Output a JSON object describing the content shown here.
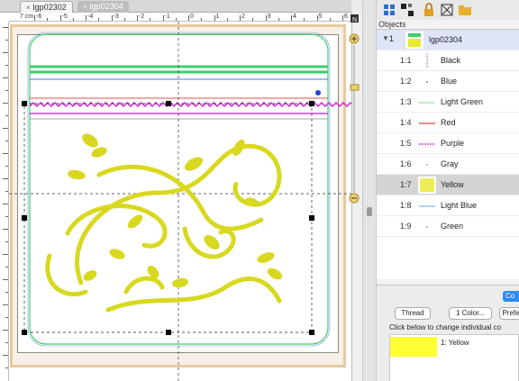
{
  "tabs": [
    {
      "label": "lgp02302",
      "active": true
    },
    {
      "label": "lgp02304",
      "active": false
    }
  ],
  "ruler": {
    "unit": "7 cm",
    "top_labels": [
      "-6",
      "-5",
      "-4",
      "-3",
      "-2",
      "-1",
      "0",
      "1",
      "2",
      "3",
      "4",
      "5",
      "6"
    ]
  },
  "objects": {
    "header": "Objects",
    "parent": {
      "index": "1",
      "name": "lgp02304"
    },
    "items": [
      {
        "index": "1:1",
        "name": "Black",
        "color": "#000000"
      },
      {
        "index": "1:2",
        "name": "Blue",
        "color": "#2046d8"
      },
      {
        "index": "1:3",
        "name": "Light Green",
        "color": "#3ccf6a"
      },
      {
        "index": "1:4",
        "name": "Red",
        "color": "#d11a1a"
      },
      {
        "index": "1:5",
        "name": "Purple",
        "color": "#d43ad4"
      },
      {
        "index": "1:6",
        "name": "Gray",
        "color": "#8c8c8c"
      },
      {
        "index": "1:7",
        "name": "Yellow",
        "color": "#e8e830"
      },
      {
        "index": "1:8",
        "name": "Light Blue",
        "color": "#5aa0e8"
      },
      {
        "index": "1:9",
        "name": "Green",
        "color": "#2a9a3a"
      }
    ]
  },
  "lower": {
    "co_tab": "Co",
    "thread_button": "Thread",
    "color_button": "1 Color...",
    "pref_button": "Prefe",
    "hint": "Click below to change individual co",
    "color_entry": "1: Yellow",
    "swatch_color": "#ffff33"
  },
  "colors": {
    "hoop": "#e6c9a0",
    "embroidery": "#d8d820"
  }
}
